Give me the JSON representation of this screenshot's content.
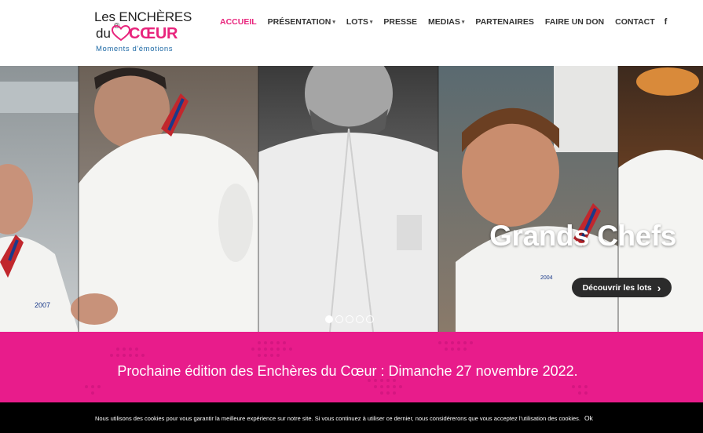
{
  "logo": {
    "line1": "Les ENCHÈRES",
    "line2_prefix": "du",
    "reg_mark": "®",
    "line2_brand": "CŒUR",
    "tagline": "Moments d'émotions"
  },
  "nav": {
    "items": [
      {
        "label": "ACCUEIL",
        "active": true,
        "dropdown": false
      },
      {
        "label": "PRÉSENTATION",
        "active": false,
        "dropdown": true
      },
      {
        "label": "LOTS",
        "active": false,
        "dropdown": true
      },
      {
        "label": "PRESSE",
        "active": false,
        "dropdown": false
      },
      {
        "label": "MEDIAS",
        "active": false,
        "dropdown": true
      },
      {
        "label": "PARTENAIRES",
        "active": false,
        "dropdown": false
      },
      {
        "label": "FAIRE UN DON",
        "active": false,
        "dropdown": false
      },
      {
        "label": "CONTACT",
        "active": false,
        "dropdown": false
      }
    ],
    "social_icon": "facebook-icon",
    "social_glyph": "f"
  },
  "hero": {
    "title": "Grands Chefs",
    "button_label": "Découvrir les lots",
    "button_glyph": "›",
    "slides": 5,
    "active_slide": 1,
    "badge_left": "2007",
    "badge_right": "2004"
  },
  "announcement": {
    "text": "Prochaine édition des Enchères du Cœur : Dimanche 27 novembre 2022."
  },
  "cookie_bar": {
    "text": "Nous utilisons des cookies pour vous garantir la meilleure expérience sur notre site. Si vous continuez à utiliser ce dernier, nous considérerons que vous acceptez l'utilisation des cookies.",
    "ok_label": "Ok"
  },
  "colors": {
    "brand_pink": "#e81c8b",
    "logo_pink": "#e8247c",
    "logo_blue": "#1f6aa6",
    "cookie_bg": "#000000"
  }
}
